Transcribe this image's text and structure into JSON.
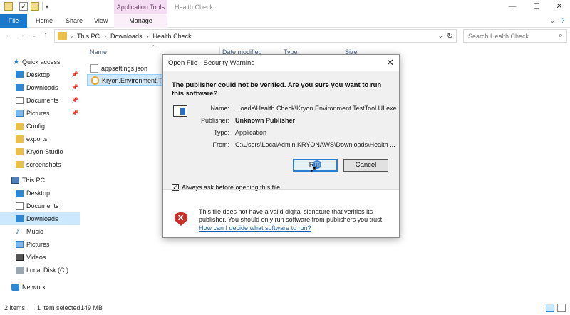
{
  "titlebar": {
    "context_tab": "Application Tools",
    "window_title": "Health Check",
    "minimize": "—",
    "maximize": "☐",
    "close": "✕"
  },
  "ribbon": {
    "file": "File",
    "home": "Home",
    "share": "Share",
    "view": "View",
    "manage": "Manage"
  },
  "address": {
    "crumbs": [
      "This PC",
      "Downloads",
      "Health Check"
    ],
    "search_placeholder": "Search Health Check"
  },
  "nav": {
    "items": [
      {
        "label": "Quick access",
        "icon": "star-icon"
      },
      {
        "label": "Desktop",
        "icon": "desktop-icon",
        "pinned": true
      },
      {
        "label": "Downloads",
        "icon": "downloads-icon",
        "pinned": true
      },
      {
        "label": "Documents",
        "icon": "documents-icon",
        "pinned": true
      },
      {
        "label": "Pictures",
        "icon": "pictures-icon",
        "pinned": true
      },
      {
        "label": "Config",
        "icon": "folder-icon"
      },
      {
        "label": "exports",
        "icon": "folder-icon"
      },
      {
        "label": "Kryon Studio",
        "icon": "folder-icon"
      },
      {
        "label": "screenshots",
        "icon": "folder-icon"
      },
      {
        "label": "This PC",
        "icon": "pc-icon"
      },
      {
        "label": "Desktop",
        "icon": "desktop-icon"
      },
      {
        "label": "Documents",
        "icon": "documents-icon"
      },
      {
        "label": "Downloads",
        "icon": "downloads-icon"
      },
      {
        "label": "Music",
        "icon": "music-icon"
      },
      {
        "label": "Pictures",
        "icon": "pictures-icon"
      },
      {
        "label": "Videos",
        "icon": "videos-icon"
      },
      {
        "label": "Local Disk (C:)",
        "icon": "disk-icon"
      },
      {
        "label": "Network",
        "icon": "network-icon"
      }
    ]
  },
  "files": {
    "columns": [
      "Name",
      "Date modified",
      "Type",
      "Size"
    ],
    "rows": [
      {
        "name": "appsettings.json"
      },
      {
        "name": "Kryon.Environment.TestTool.UI.exe"
      }
    ]
  },
  "status": {
    "items": "2 items",
    "selected": "1 item selected",
    "size": "149 MB"
  },
  "dialog": {
    "title": "Open File - Security Warning",
    "question": "The publisher could not be verified.  Are you sure you want to run this software?",
    "name_label": "Name:",
    "name_value": "...oads\\Health Check\\Kryon.Environment.TestTool.UI.exe",
    "publisher_label": "Publisher:",
    "publisher_value": "Unknown Publisher",
    "type_label": "Type:",
    "type_value": "Application",
    "from_label": "From:",
    "from_value": "C:\\Users\\LocalAdmin.KRYONAWS\\Downloads\\Health ...",
    "run_button": "Run",
    "cancel_button": "Cancel",
    "checkbox_label": "Always ask before opening this file",
    "checkbox_checked": true,
    "warning_text": "This file does not have a valid digital signature that verifies its publisher.  You should only run software from publishers you trust.",
    "link_text": "How can I decide what software to run?"
  }
}
